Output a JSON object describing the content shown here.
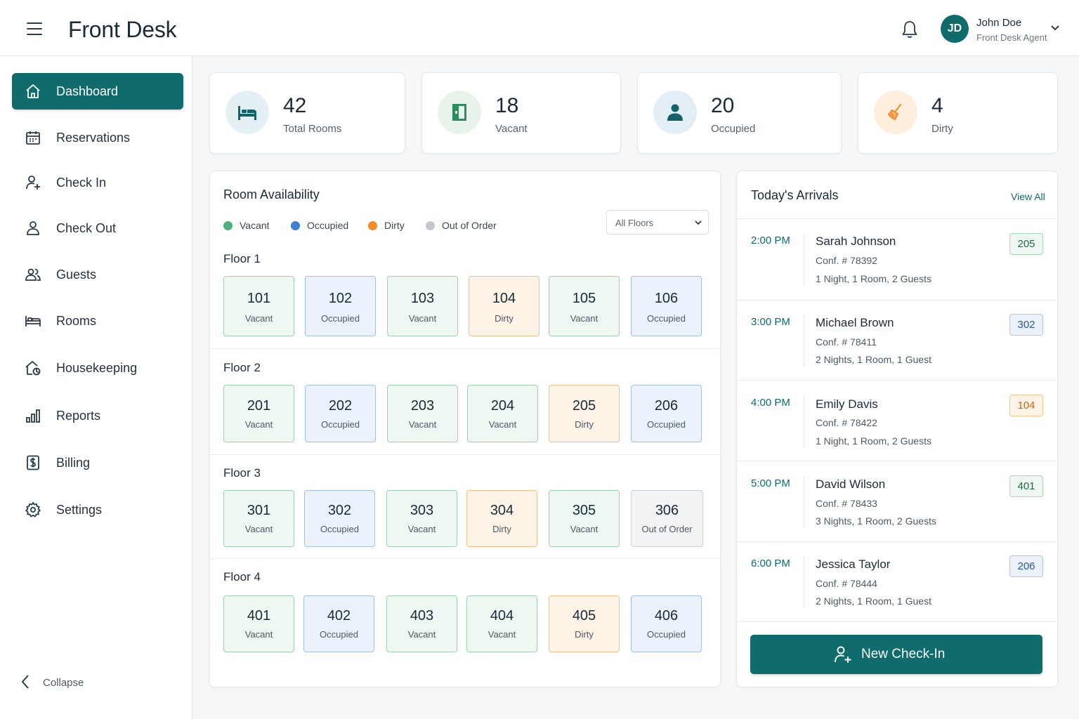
{
  "header": {
    "title": "Front Desk",
    "user": {
      "initials": "JD",
      "name": "John Doe",
      "role": "Front Desk Agent"
    }
  },
  "sidebar": {
    "items": [
      {
        "label": "Dashboard",
        "icon": "home-icon",
        "active": true
      },
      {
        "label": "Reservations",
        "icon": "calendar-icon"
      },
      {
        "label": "Check In",
        "icon": "user-plus-icon"
      },
      {
        "label": "Check Out",
        "icon": "user-icon"
      },
      {
        "label": "Guests",
        "icon": "users-icon"
      },
      {
        "label": "Rooms",
        "icon": "bed-icon"
      },
      {
        "label": "Housekeeping",
        "icon": "house-cleaning-icon"
      },
      {
        "label": "Reports",
        "icon": "bar-chart-icon"
      },
      {
        "label": "Billing",
        "icon": "dollar-icon"
      },
      {
        "label": "Settings",
        "icon": "gear-icon"
      }
    ],
    "collapse_label": "Collapse"
  },
  "stats": [
    {
      "value": "42",
      "label": "Total Rooms",
      "icon": "bed-icon"
    },
    {
      "value": "18",
      "label": "Vacant",
      "icon": "door-icon"
    },
    {
      "value": "20",
      "label": "Occupied",
      "icon": "person-icon"
    },
    {
      "value": "4",
      "label": "Dirty",
      "icon": "broom-icon"
    }
  ],
  "availability": {
    "title": "Room Availability",
    "legend": [
      {
        "label": "Vacant",
        "color": "#4caf7d"
      },
      {
        "label": "Occupied",
        "color": "#3f7fd6"
      },
      {
        "label": "Dirty",
        "color": "#f28c28"
      },
      {
        "label": "Out of Order",
        "color": "#c4c8cc"
      }
    ],
    "floor_filter": "All Floors",
    "floors": [
      {
        "label": "Floor 1",
        "rooms": [
          {
            "number": "101",
            "status": "Vacant"
          },
          {
            "number": "102",
            "status": "Occupied"
          },
          {
            "number": "103",
            "status": "Vacant"
          },
          {
            "number": "104",
            "status": "Dirty"
          },
          {
            "number": "105",
            "status": "Vacant"
          },
          {
            "number": "106",
            "status": "Occupied"
          }
        ]
      },
      {
        "label": "Floor 2",
        "rooms": [
          {
            "number": "201",
            "status": "Vacant"
          },
          {
            "number": "202",
            "status": "Occupied"
          },
          {
            "number": "203",
            "status": "Vacant"
          },
          {
            "number": "204",
            "status": "Vacant"
          },
          {
            "number": "205",
            "status": "Dirty"
          },
          {
            "number": "206",
            "status": "Occupied"
          }
        ]
      },
      {
        "label": "Floor 3",
        "rooms": [
          {
            "number": "301",
            "status": "Vacant"
          },
          {
            "number": "302",
            "status": "Occupied"
          },
          {
            "number": "303",
            "status": "Vacant"
          },
          {
            "number": "304",
            "status": "Dirty"
          },
          {
            "number": "305",
            "status": "Vacant"
          },
          {
            "number": "306",
            "status": "Out of Order"
          }
        ]
      },
      {
        "label": "Floor 4",
        "rooms": [
          {
            "number": "401",
            "status": "Vacant"
          },
          {
            "number": "402",
            "status": "Occupied"
          },
          {
            "number": "403",
            "status": "Vacant"
          },
          {
            "number": "404",
            "status": "Vacant"
          },
          {
            "number": "405",
            "status": "Dirty"
          },
          {
            "number": "406",
            "status": "Occupied"
          }
        ]
      }
    ]
  },
  "arrivals": {
    "title": "Today's Arrivals",
    "view_all": "View All",
    "items": [
      {
        "time": "2:00 PM",
        "name": "Sarah Johnson",
        "conf": "Conf. # 78392",
        "info": "1 Night, 1 Room, 2 Guests",
        "room": "205",
        "room_status": "Vacant"
      },
      {
        "time": "3:00 PM",
        "name": "Michael Brown",
        "conf": "Conf. # 78411",
        "info": "2 Nights, 1 Room, 1 Guest",
        "room": "302",
        "room_status": "Occupied"
      },
      {
        "time": "4:00 PM",
        "name": "Emily Davis",
        "conf": "Conf. # 78422",
        "info": "1 Night, 1 Room, 2 Guests",
        "room": "104",
        "room_status": "Dirty"
      },
      {
        "time": "5:00 PM",
        "name": "David Wilson",
        "conf": "Conf. # 78433",
        "info": "3 Nights, 1 Room, 2 Guests",
        "room": "401",
        "room_status": "Vacant"
      },
      {
        "time": "6:00 PM",
        "name": "Jessica Taylor",
        "conf": "Conf. # 78444",
        "info": "2 Nights, 1 Room, 1 Guest",
        "room": "206",
        "room_status": "Occupied"
      }
    ],
    "new_checkin_label": "New Check-In"
  },
  "colors": {
    "accent": "#0f6b6c"
  }
}
